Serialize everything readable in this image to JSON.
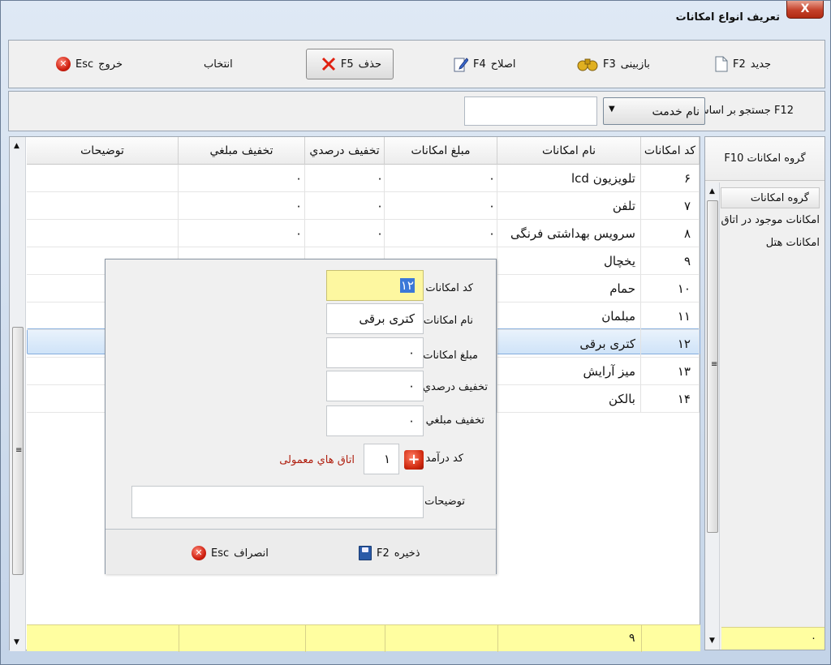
{
  "window": {
    "title": "تعریف انواع امکانات",
    "close_label": "X"
  },
  "toolbar": {
    "new": {
      "label": "جدید",
      "key": "F2"
    },
    "review": {
      "label": "بازبینی",
      "key": "F3"
    },
    "edit": {
      "label": "اصلاح",
      "key": "F4"
    },
    "delete": {
      "label": "حذف",
      "key": "F5"
    },
    "select": {
      "label": "انتخاب"
    },
    "exit": {
      "label": "خروج",
      "key": "Esc"
    }
  },
  "search": {
    "label": "F12 جستجو بر اساس :",
    "field_value": "نام خدمت",
    "input_value": ""
  },
  "grid": {
    "columns": [
      "کد امکانات",
      "نام امکانات",
      "مبلغ امکانات",
      "تخفیف درصدي",
      "تخفیف مبلغي",
      "توضيحات"
    ],
    "rows": [
      {
        "code": "۶",
        "name": "تلویزیون lcd",
        "amount": "۰",
        "pct": "۰",
        "fixed": "۰",
        "desc": ""
      },
      {
        "code": "۷",
        "name": "تلفن",
        "amount": "۰",
        "pct": "۰",
        "fixed": "۰",
        "desc": ""
      },
      {
        "code": "۸",
        "name": "سرویس بهداشتی فرنگی",
        "amount": "۰",
        "pct": "۰",
        "fixed": "۰",
        "desc": ""
      },
      {
        "code": "۹",
        "name": "یخچال",
        "amount": "",
        "pct": "",
        "fixed": "",
        "desc": ""
      },
      {
        "code": "۱۰",
        "name": "حمام",
        "amount": "",
        "pct": "",
        "fixed": "",
        "desc": ""
      },
      {
        "code": "۱۱",
        "name": "مبلمان",
        "amount": "",
        "pct": "",
        "fixed": "",
        "desc": ""
      },
      {
        "code": "۱۲",
        "name": "کتری برقی",
        "amount": "",
        "pct": "",
        "fixed": "",
        "desc": ""
      },
      {
        "code": "۱۳",
        "name": "میز آرایش",
        "amount": "",
        "pct": "",
        "fixed": "",
        "desc": ""
      },
      {
        "code": "۱۴",
        "name": "بالکن",
        "amount": "",
        "pct": "",
        "fixed": "",
        "desc": ""
      }
    ],
    "footer_count": "۹"
  },
  "side": {
    "header": "گروه امکانات F10",
    "items": [
      "گروه امکانات",
      "امکانات موجود در اتاق",
      "امکانات هتل"
    ],
    "footer_value": "۰"
  },
  "dialog": {
    "code_label": "کد امکانات",
    "code_value": "۱۲",
    "name_label": "نام امکانات",
    "name_value": "کتری برقی",
    "amount_label": "مبلغ امکانات",
    "amount_value": "۰",
    "pct_label": "تخفیف درصدي",
    "pct_value": "۰",
    "fixed_label": "تخفیف مبلغي",
    "fixed_value": "۰",
    "income_label": "کد درآمد",
    "income_code": "۱",
    "income_name": "اتاق هاي معمولی",
    "desc_label": "توضيحات",
    "desc_value": "",
    "save": {
      "label": "ذخیره",
      "key": "F2"
    },
    "cancel": {
      "label": "انصراف",
      "key": "Esc"
    }
  },
  "colors": {
    "selection": "#cfe3f8",
    "footer": "#fffea0",
    "code_field": "#fdf7a0",
    "income_name": "#b02010"
  }
}
